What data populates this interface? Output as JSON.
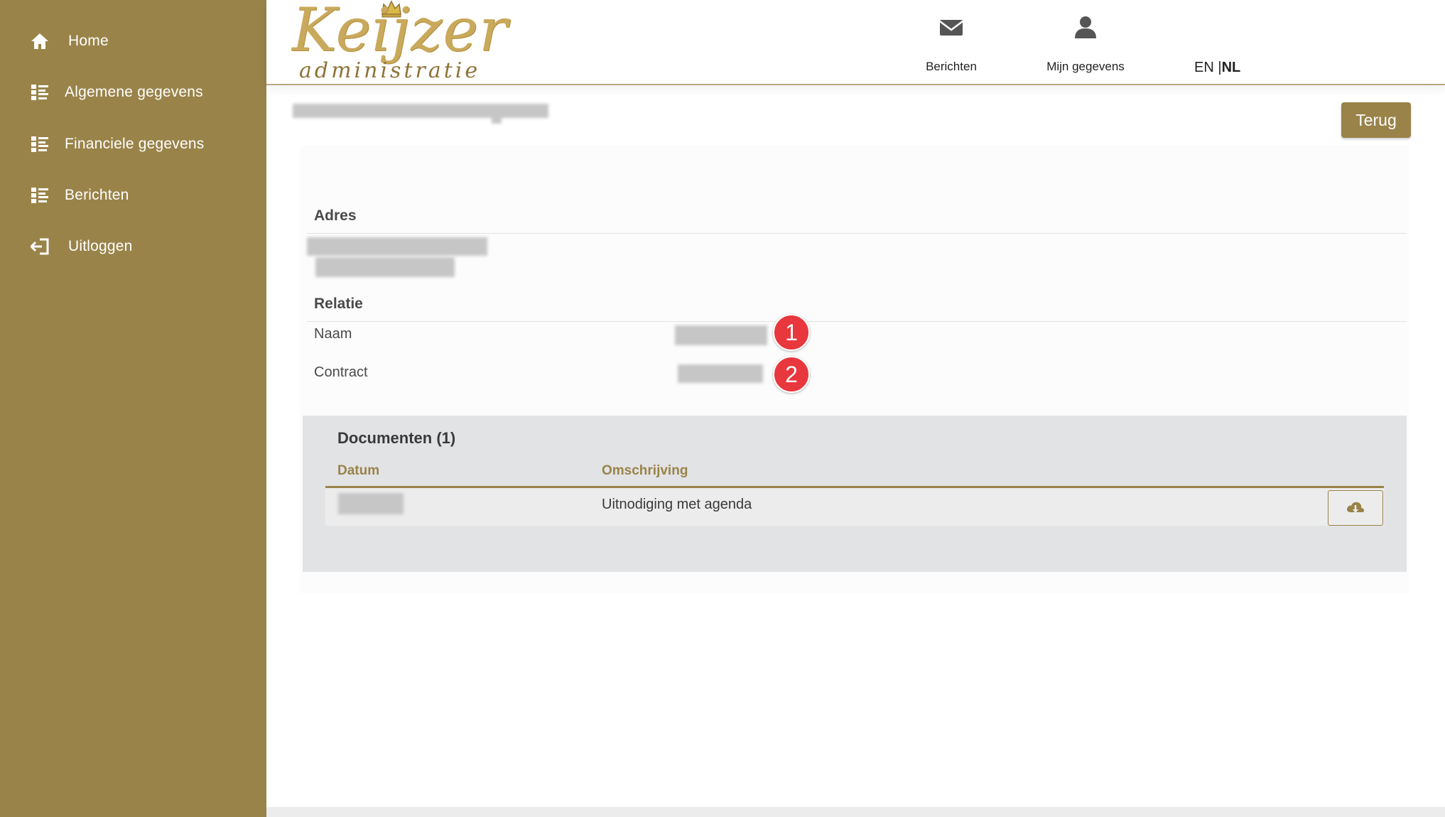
{
  "sidebar": {
    "items": [
      {
        "label": "Home",
        "icon": "home-icon"
      },
      {
        "label": "Algemene gegevens",
        "icon": "list-icon"
      },
      {
        "label": "Financiele gegevens",
        "icon": "list-icon"
      },
      {
        "label": "Berichten",
        "icon": "list-icon"
      },
      {
        "label": "Uitloggen",
        "icon": "logout-icon"
      }
    ]
  },
  "header": {
    "logo_main": "Keijzer",
    "logo_sub": "administratie",
    "links": [
      {
        "label": "Berichten",
        "icon": "envelope-icon"
      },
      {
        "label": "Mijn gegevens",
        "icon": "user-icon"
      }
    ],
    "lang": {
      "en": "EN",
      "separator": " |",
      "nl": "NL",
      "active": "NL"
    }
  },
  "main": {
    "back_button": "Terug",
    "address_heading": "Adres",
    "relation_heading": "Relatie",
    "fields": [
      {
        "label": "Naam",
        "badge": "1"
      },
      {
        "label": "Contract",
        "badge": "2"
      }
    ],
    "documents": {
      "title": "Documenten (1)",
      "columns": [
        "Datum",
        "Omschrijving"
      ],
      "rows": [
        {
          "description": "Uitnodiging met agenda",
          "action_icon": "cloud-download-icon"
        }
      ]
    }
  },
  "colors": {
    "brand": "#998349",
    "badge": "#e8373d",
    "docs_bg": "#e2e3e5"
  }
}
